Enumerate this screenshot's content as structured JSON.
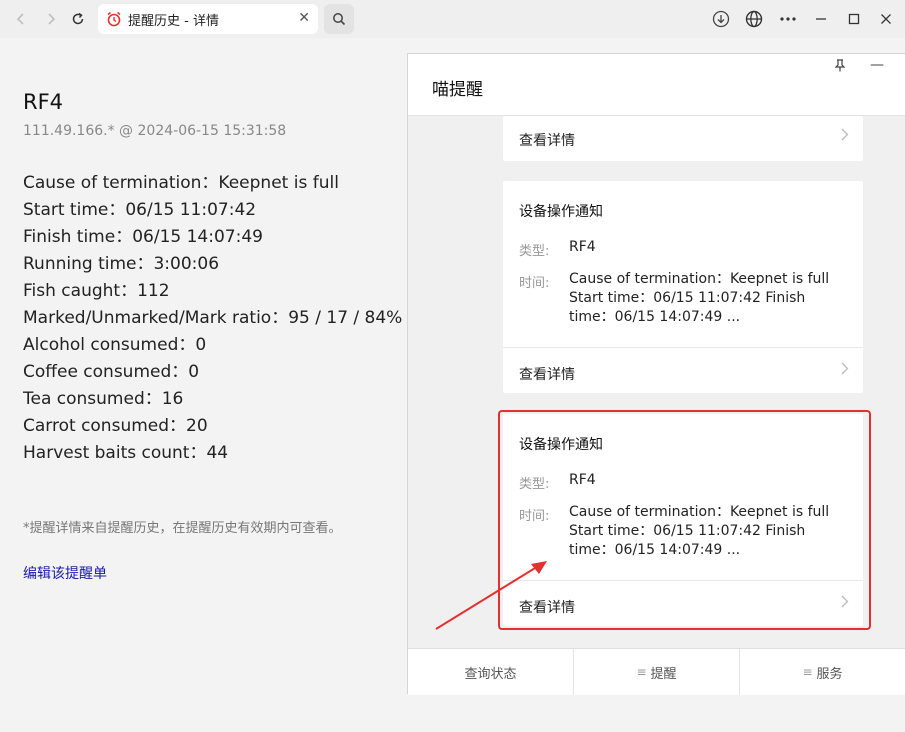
{
  "browser": {
    "tab_title": "提醒历史 - 详情",
    "close_glyph": "✕",
    "back_glyph": "‹",
    "forward_glyph": "›",
    "reload_glyph": "↻",
    "search_icon": "search-icon",
    "tab_icon_color": "#e53030"
  },
  "page": {
    "title": "RF4",
    "subtitle": "111.49.166.* @ 2024-06-15 15:31:58",
    "details": [
      "Cause of termination：Keepnet is full",
      "Start time：06/15 11:07:42",
      "Finish time：06/15 14:07:49",
      "Running time：3:00:06",
      "Fish caught：112",
      "Marked/Unmarked/Mark ratio：95 / 17 / 84%",
      "Alcohol consumed：0",
      "Coffee consumed：0",
      "Tea consumed：16",
      "Carrot consumed：20",
      "Harvest baits count：44"
    ],
    "note": "*提醒详情来自提醒历史，在提醒历史有效期内可查看。",
    "edit_link": "编辑该提醒单"
  },
  "panel": {
    "title": "喵提醒",
    "pin_glyph": "⊥",
    "min_glyph": "—",
    "top_card_link": "查看详情",
    "cards": [
      {
        "title": "设备操作通知",
        "type_label": "类型:",
        "type_value": "RF4",
        "time_label": "时间:",
        "time_value": "Cause of termination：Keepnet is full Start time：06/15 11:07:42 Finish time：06/15 14:07:49 ...",
        "link": "查看详情"
      },
      {
        "title": "设备操作通知",
        "type_label": "类型:",
        "type_value": "RF4",
        "time_label": "时间:",
        "time_value": "Cause of termination：Keepnet is full Start time：06/15 11:07:42 Finish time：06/15 14:07:49 ...",
        "link": "查看详情"
      }
    ],
    "footer": {
      "status": "查询状态",
      "remind": "提醒",
      "service": "服务"
    }
  },
  "colors": {
    "highlight": "#e53030",
    "link": "#1a1ab0"
  }
}
